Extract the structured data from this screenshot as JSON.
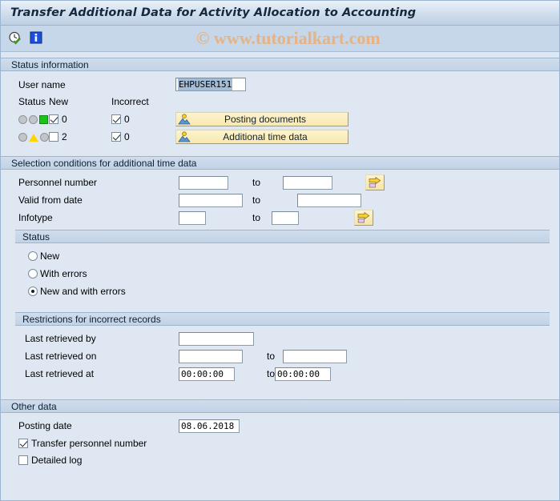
{
  "window": {
    "title": "Transfer Additional Data for Activity Allocation to Accounting"
  },
  "toolbar": {
    "execute_icon": "clock-check-icon",
    "info_icon": "info-icon",
    "watermark": "© www.tutorialkart.com"
  },
  "status_information": {
    "header": "Status information",
    "user_name_label": "User name",
    "user_name_value": "EHPUSER151",
    "columns": {
      "status": "Status",
      "new": "New",
      "incorrect": "Incorrect"
    },
    "rows": [
      {
        "lamp": "green",
        "new_checked": true,
        "new_count": "0",
        "incorrect_checked": true,
        "incorrect_count": "0",
        "button_label": "Posting documents",
        "button_icon": "person-document-icon"
      },
      {
        "lamp": "yellow",
        "new_checked": false,
        "new_count": "2",
        "incorrect_checked": true,
        "incorrect_count": "0",
        "button_label": "Additional time data",
        "button_icon": "person-document-icon"
      }
    ]
  },
  "selection_conditions": {
    "header": "Selection conditions for additional time data",
    "to_label": "to",
    "multi_select_icon": "multi-select-arrow-icon",
    "fields": [
      {
        "label": "Personnel number",
        "from_value": "",
        "to_value": "",
        "from_width": 62,
        "to_width": 62,
        "has_multiselect": true
      },
      {
        "label": "Valid from date",
        "from_value": "",
        "to_value": "",
        "from_width": 80,
        "to_width": 80,
        "has_multiselect": false
      },
      {
        "label": "Infotype",
        "from_value": "",
        "to_value": "",
        "from_width": 34,
        "to_width": 34,
        "has_multiselect": true
      }
    ],
    "status_group": {
      "header": "Status",
      "options": [
        {
          "label": "New",
          "selected": false
        },
        {
          "label": "With errors",
          "selected": false
        },
        {
          "label": "New and with errors",
          "selected": true
        }
      ]
    },
    "restrictions_group": {
      "header": "Restrictions for incorrect records",
      "to_label": "to",
      "fields": [
        {
          "label": "Last retrieved by",
          "from_value": "",
          "to_value": null,
          "from_width": 94,
          "to_width": 0,
          "has_to": false
        },
        {
          "label": "Last retrieved on",
          "from_value": "",
          "to_value": "",
          "from_width": 80,
          "to_width": 80,
          "has_to": true
        },
        {
          "label": "Last retrieved at",
          "from_value": "00:00:00",
          "to_value": "00:00:00",
          "from_width": 70,
          "to_width": 70,
          "has_to": true
        }
      ]
    }
  },
  "other_data": {
    "header": "Other data",
    "posting_date_label": "Posting date",
    "posting_date_value": "08.06.2018",
    "transfer_personnel_number_label": "Transfer personnel number",
    "transfer_personnel_number_checked": true,
    "detailed_log_label": "Detailed log",
    "detailed_log_checked": false
  },
  "colors": {
    "background": "#dfe8f2",
    "section_header": "#c6d6e8",
    "title_text": "#14293f",
    "button_yellow": "#fbeec0",
    "watermark": "#e8b281",
    "lamp_green": "#19c419",
    "lamp_yellow": "#ffd500",
    "selection_highlight": "#a4bdd7"
  }
}
